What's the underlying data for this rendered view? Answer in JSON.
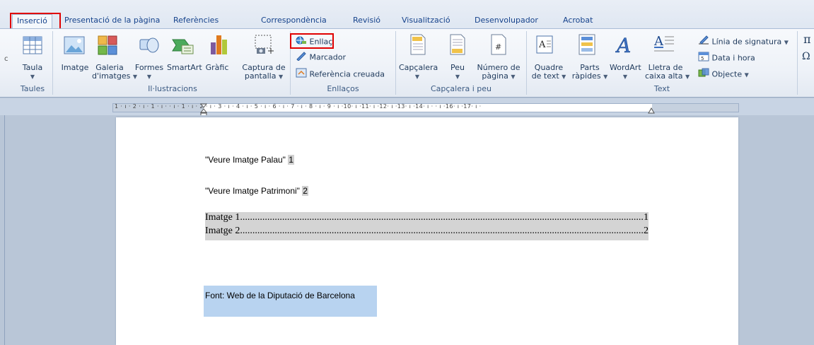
{
  "tabs": [
    "Inserció",
    "Presentació de la pàgina",
    "Referències",
    "Correspondència",
    "Revisió",
    "Visualització",
    "Desenvolupador",
    "Acrobat"
  ],
  "groups": {
    "taules": {
      "label": "Taules",
      "taula": "Taula"
    },
    "illustracions": {
      "label": "Il·lustracions",
      "imatge": "Imatge",
      "galeria_1": "Galeria",
      "galeria_2": "d'imatges",
      "formes": "Formes",
      "smartart": "SmartArt",
      "grafic": "Gràfic",
      "captura_1": "Captura de",
      "captura_2": "pantalla"
    },
    "enllacos": {
      "label": "Enllaços",
      "enllac": "Enllaç",
      "marcador": "Marcador",
      "referencia": "Referència creuada"
    },
    "capcalera": {
      "label": "Capçalera i peu",
      "capcalera": "Capçalera",
      "peu": "Peu",
      "numero_1": "Número de",
      "numero_2": "pàgina"
    },
    "text": {
      "label": "Text",
      "quadre_1": "Quadre",
      "quadre_2": "de text",
      "parts_1": "Parts",
      "parts_2": "ràpides",
      "wordart": "WordArt",
      "lletra_1": "Lletra de",
      "lletra_2": "caixa alta",
      "linia": "Línia de signatura",
      "data": "Data i hora",
      "objecte": "Objecte"
    },
    "symbols": {
      "pi": "π",
      "omega": "Ω"
    }
  },
  "ruler": {
    "ticks": "1 · ı · 2 · ı · 1 · ı ·   · ı · 1 · ı · 2 · ı · 3 · ı · 4 · ı · 5 · ı · 6 · ı · 7 · ı · 8 · ı · 9 · ı ·10· ı ·11· ı ·12· ı ·13· ı ·14· ı ·   · ı ·16· ı ·17· ı ·"
  },
  "document": {
    "line1_text": "\"Veure Imatge Palau\"",
    "line1_num": "1",
    "line2_text": "\"Veure Imatge Patrimoni\"",
    "line2_num": "2",
    "toc": [
      {
        "label": "Imatge 1",
        "page": "1"
      },
      {
        "label": "Imatge 2",
        "page": "2"
      }
    ],
    "source": "Font: Web de la Diputació de Barcelona"
  },
  "colors": {
    "highlight_red": "#e00000",
    "selection": "#b8d3f0"
  }
}
